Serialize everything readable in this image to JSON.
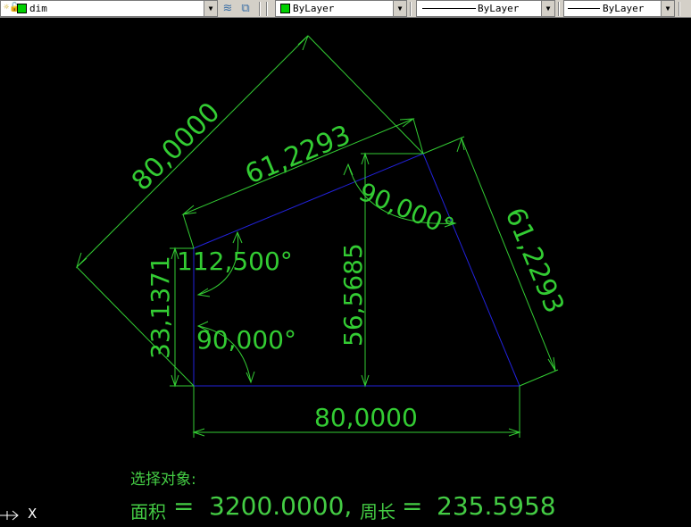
{
  "toolbar": {
    "layer_name": "dim",
    "color_value": "ByLayer",
    "linetype_value": "ByLayer",
    "lineweight_value": "ByLayer",
    "layer_state_icon": "layer-states-icon",
    "layer_previous_icon": "layer-previous-icon",
    "dropdown_icon": "chevron-down-icon",
    "accent_green": "#00d000"
  },
  "drawing": {
    "line_colors": {
      "dimension": "#33cc33",
      "shape": "#2222dd"
    },
    "dimensions": {
      "aligned_long": "80,0000",
      "aligned_top": "61,2293",
      "aligned_right": "61,2293",
      "vertical_left": "33,1371",
      "vertical_mid": "56,5685",
      "horizontal_bottom": "80,0000",
      "angle_top_right": "90,000°",
      "angle_top_left": "112,500°",
      "angle_bottom_left": "90,000°"
    }
  },
  "command_line": {
    "prompt": "选择对象:",
    "area_label": "面积",
    "area_eq": "=",
    "area_value": "3200.0000,",
    "perimeter_label": "周长",
    "perimeter_eq": "=",
    "perimeter_value": "235.5958"
  },
  "ucs": {
    "axis_label": "X",
    "icon": "ucs-icon"
  }
}
